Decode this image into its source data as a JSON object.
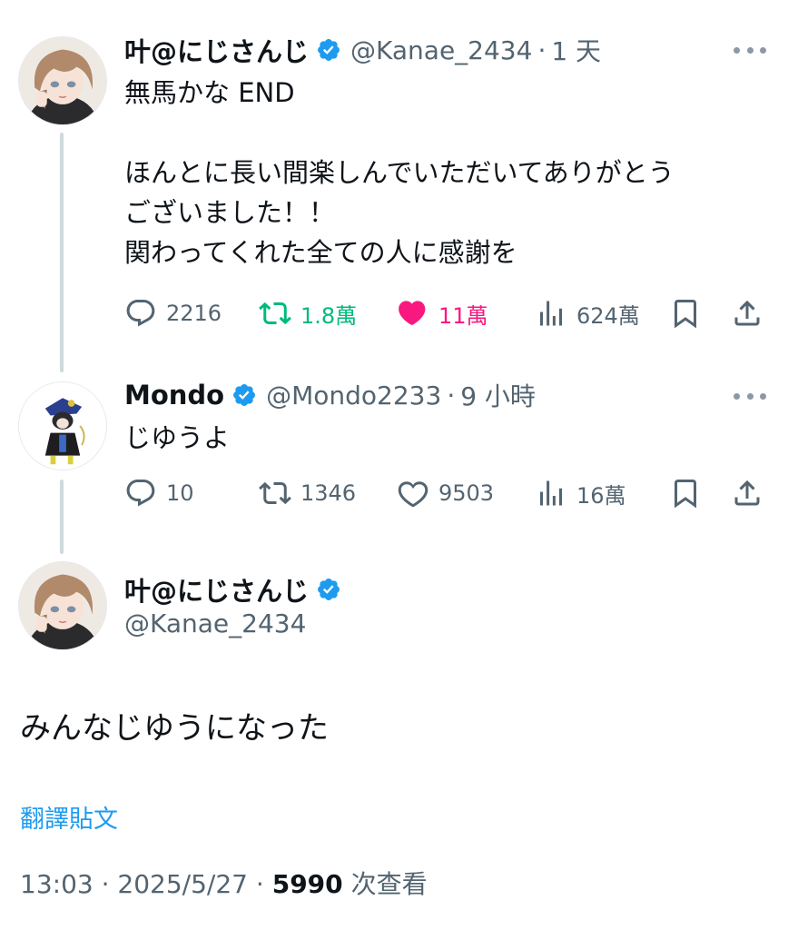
{
  "tweets": [
    {
      "name": "叶@にじさんじ",
      "handle": "@Kanae_2434",
      "separator": "·",
      "time": "1 天",
      "lines": [
        "無馬かな END",
        "",
        "ほんとに長い間楽しんでいただいてありがとう",
        "ございました！！",
        "関わってくれた全ての人に感謝を"
      ],
      "replies": "2216",
      "retweets": "1.8萬",
      "likes": "11萬",
      "views": "624萬",
      "retweeted": true,
      "liked": true
    },
    {
      "name": "Mondo",
      "handle": "@Mondo2233",
      "separator": "·",
      "time": "9 小時",
      "lines": [
        "じゆうよ"
      ],
      "replies": "10",
      "retweets": "1346",
      "likes": "9503",
      "views": "16萬",
      "retweeted": false,
      "liked": false
    }
  ],
  "main_tweet": {
    "name": "叶@にじさんじ",
    "handle": "@Kanae_2434",
    "text": "みんなじゆうになった",
    "translate_label": "翻譯貼文",
    "time": "13:03",
    "separator": "·",
    "date": "2025/5/27",
    "views_count": "5990",
    "views_label": "次查看"
  },
  "colors": {
    "verified": "#1d9bf0",
    "retweet": "#00ba7c",
    "like": "#f91880",
    "secondary_text": "#536471",
    "link": "#1d9bf0"
  }
}
